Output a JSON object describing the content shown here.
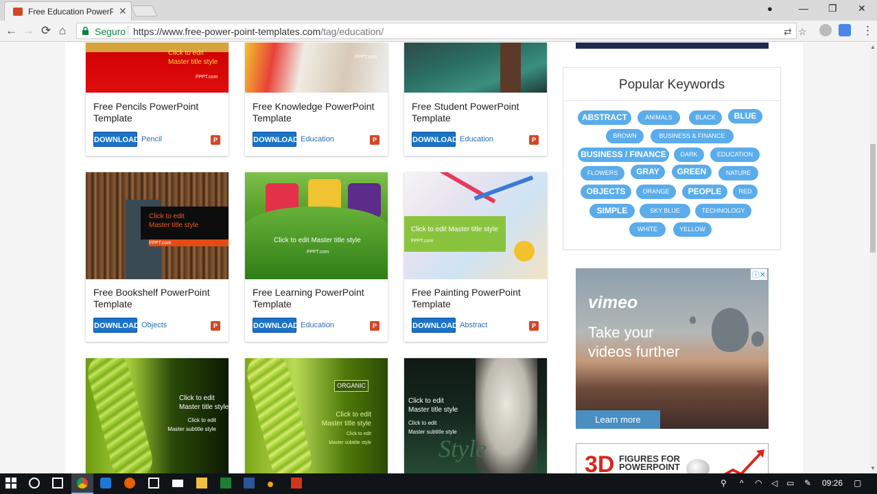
{
  "browser": {
    "tab_title": "Free Education PowerPoi",
    "tab_close": "✕",
    "security_label": "Seguro",
    "url_base": "https://www.free-power-point-templates.com",
    "url_path": "/tag/education/",
    "window_controls": {
      "minimize": "—",
      "restore": "❐",
      "close": "✕"
    },
    "nav_icons": {
      "back": "←",
      "forward": "→",
      "reload": "⟳",
      "home": "⌂",
      "star": "☆",
      "menu": "⋮",
      "user": "●"
    }
  },
  "cards": [
    {
      "title": "Free Pencils PowerPoint Template",
      "download": "DOWNLOAD",
      "category": "Pencil",
      "thumb_text": "Click to edit\nMaster title style",
      "thumb_brand": "FPPT.com"
    },
    {
      "title": "Free Knowledge PowerPoint Template",
      "download": "DOWNLOAD",
      "category": "Education",
      "thumb_brand": "FPPT.com"
    },
    {
      "title": "Free Student PowerPoint Template",
      "download": "DOWNLOAD",
      "category": "Education"
    },
    {
      "title": "Free Bookshelf PowerPoint Template",
      "download": "DOWNLOAD",
      "category": "Objects",
      "thumb_text": "Click to edit\nMaster title style",
      "thumb_brand": "FPPT.com"
    },
    {
      "title": "Free Learning PowerPoint Template",
      "download": "DOWNLOAD",
      "category": "Education",
      "thumb_text": "Click to edit Master title style",
      "thumb_brand": "FPPT.com"
    },
    {
      "title": "Free Painting PowerPoint Template",
      "download": "DOWNLOAD",
      "category": "Abstract",
      "thumb_text": "Click to edit Master title style",
      "thumb_brand": "FPPT.com"
    },
    {
      "thumb_text": "Click to edit\nMaster title style",
      "thumb_sub": "Click to edit\nMaster subtitle style"
    },
    {
      "thumb_badge": "ORGANIC",
      "thumb_text": "Click to edit\nMaster title style",
      "thumb_sub": "Click to edit\nMaster subtitle style"
    },
    {
      "thumb_text": "Click to edit\nMaster title style",
      "thumb_sub": "Click to edit\nMaster subtitle style",
      "thumb_style": "Style"
    }
  ],
  "keywords": {
    "title": "Popular Keywords",
    "items": [
      "ABSTRACT",
      "ANIMALS",
      "BLACK",
      "BLUE",
      "BROWN",
      "BUSINESS & FINANCE",
      "BUSINESS / FINANCE",
      "DARK",
      "EDUCATION",
      "FLOWERS",
      "GRAY",
      "GREEN",
      "NATURE",
      "OBJECTS",
      "ORANGE",
      "PEOPLE",
      "RED",
      "SIMPLE",
      "SKY BLUE",
      "TECHNOLOGY",
      "WHITE",
      "YELLOW"
    ]
  },
  "ad_vimeo": {
    "logo": "vimeo",
    "headline": "Take your\nvideos further",
    "button": "Learn more",
    "badge": "ⓘ✕"
  },
  "ad_figures": {
    "big": "3D",
    "text": "FIGURES FOR\nPOWERPOINT"
  },
  "taskbar": {
    "time": "09:26"
  },
  "colors": {
    "accent": "#1a73c9",
    "keyword": "#5aacea",
    "ppt": "#d24726"
  }
}
